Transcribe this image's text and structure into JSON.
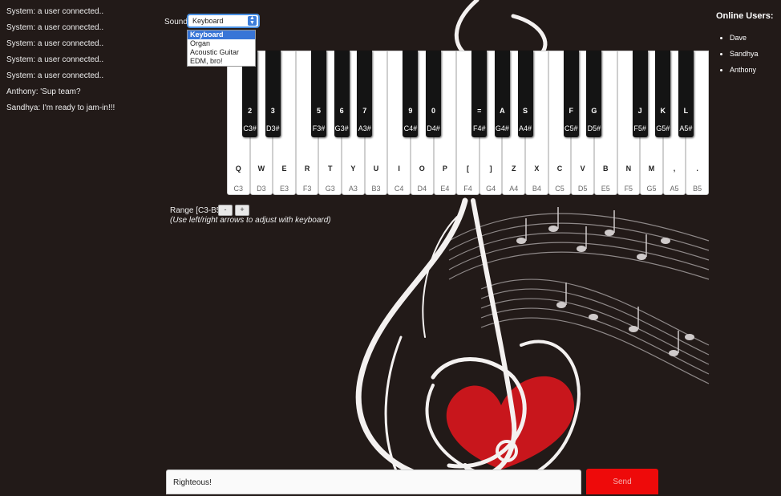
{
  "chat": {
    "messages": [
      "System: a user connected..",
      "System: a user connected..",
      "System: a user connected..",
      "System: a user connected..",
      "System: a user connected..",
      "Anthony: 'Sup team?",
      "Sandhya: I'm ready to jam-in!!!"
    ]
  },
  "sound": {
    "label": "Sound",
    "selected": "Keyboard",
    "options": [
      "Keyboard",
      "Organ",
      "Acoustic Guitar",
      "EDM, bro!"
    ]
  },
  "piano": {
    "white_keys": [
      {
        "key": "Q",
        "note": "C3"
      },
      {
        "key": "W",
        "note": "D3"
      },
      {
        "key": "E",
        "note": "E3"
      },
      {
        "key": "R",
        "note": "F3"
      },
      {
        "key": "T",
        "note": "G3"
      },
      {
        "key": "Y",
        "note": "A3"
      },
      {
        "key": "U",
        "note": "B3"
      },
      {
        "key": "I",
        "note": "C4"
      },
      {
        "key": "O",
        "note": "D4"
      },
      {
        "key": "P",
        "note": "E4"
      },
      {
        "key": "[",
        "note": "F4"
      },
      {
        "key": "]",
        "note": "G4"
      },
      {
        "key": "Z",
        "note": "A4"
      },
      {
        "key": "X",
        "note": "B4"
      },
      {
        "key": "C",
        "note": "C5"
      },
      {
        "key": "V",
        "note": "D5"
      },
      {
        "key": "B",
        "note": "E5"
      },
      {
        "key": "N",
        "note": "F5"
      },
      {
        "key": "M",
        "note": "G5"
      },
      {
        "key": ",",
        "note": "A5"
      },
      {
        "key": ".",
        "note": "B5"
      }
    ],
    "black_keys": [
      {
        "key": "2",
        "note": "C3#",
        "after": 0
      },
      {
        "key": "3",
        "note": "D3#",
        "after": 1
      },
      {
        "key": "5",
        "note": "F3#",
        "after": 3
      },
      {
        "key": "6",
        "note": "G3#",
        "after": 4
      },
      {
        "key": "7",
        "note": "A3#",
        "after": 5
      },
      {
        "key": "9",
        "note": "C4#",
        "after": 7
      },
      {
        "key": "0",
        "note": "D4#",
        "after": 8
      },
      {
        "key": "=",
        "note": "F4#",
        "after": 10
      },
      {
        "key": "A",
        "note": "G4#",
        "after": 11
      },
      {
        "key": "S",
        "note": "A4#",
        "after": 12
      },
      {
        "key": "F",
        "note": "C5#",
        "after": 14
      },
      {
        "key": "G",
        "note": "D5#",
        "after": 15
      },
      {
        "key": "J",
        "note": "F5#",
        "after": 17
      },
      {
        "key": "K",
        "note": "G5#",
        "after": 18
      },
      {
        "key": "L",
        "note": "A5#",
        "after": 19
      }
    ]
  },
  "range": {
    "label": "Range [C3-B5]",
    "minus": "-",
    "plus": "+",
    "hint": "(Use left/right arrows to adjust with keyboard)"
  },
  "online": {
    "title": "Online Users:",
    "users": [
      "Dave",
      "Sandhya",
      "Anthony"
    ]
  },
  "composer": {
    "message_value": "Righteous!",
    "send_label": "Send"
  },
  "colors": {
    "background": "#221a18",
    "send": "#ee0a0a",
    "heart": "#c8161c"
  }
}
